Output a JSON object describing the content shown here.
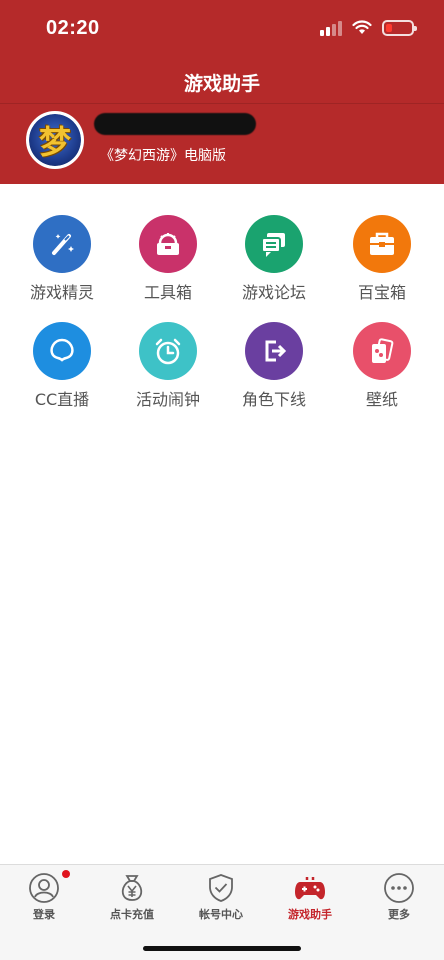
{
  "status_bar": {
    "time": "02:20"
  },
  "header": {
    "title": "游戏助手"
  },
  "profile": {
    "game_name": "《梦幻西游》电脑版",
    "avatar_glyph": "梦"
  },
  "tools": [
    {
      "label": "游戏精灵",
      "icon": "magic-wand-icon",
      "color": "#2f6fc4"
    },
    {
      "label": "工具箱",
      "icon": "toolbox-icon",
      "color": "#c9326a"
    },
    {
      "label": "游戏论坛",
      "icon": "forum-icon",
      "color": "#1aa36f"
    },
    {
      "label": "百宝箱",
      "icon": "treasure-box-icon",
      "color": "#f2780c"
    },
    {
      "label": "CC直播",
      "icon": "cc-live-icon",
      "color": "#1e8ee0"
    },
    {
      "label": "活动闹钟",
      "icon": "alarm-clock-icon",
      "color": "#3ec2c7"
    },
    {
      "label": "角色下线",
      "icon": "logout-icon",
      "color": "#6a3fa0"
    },
    {
      "label": "壁纸",
      "icon": "wallpaper-icon",
      "color": "#e8506a"
    }
  ],
  "tabbar": {
    "items": [
      {
        "label": "登录",
        "icon": "user-icon",
        "active": false,
        "badge": true
      },
      {
        "label": "点卡充值",
        "icon": "money-bag-icon",
        "active": false
      },
      {
        "label": "帐号中心",
        "icon": "shield-check-icon",
        "active": false
      },
      {
        "label": "游戏助手",
        "icon": "gamepad-icon",
        "active": true
      },
      {
        "label": "更多",
        "icon": "more-icon",
        "active": false
      }
    ]
  },
  "colors": {
    "header_bg": "#b52a2a",
    "tab_active": "#c4252b",
    "badge": "#e0141e"
  }
}
